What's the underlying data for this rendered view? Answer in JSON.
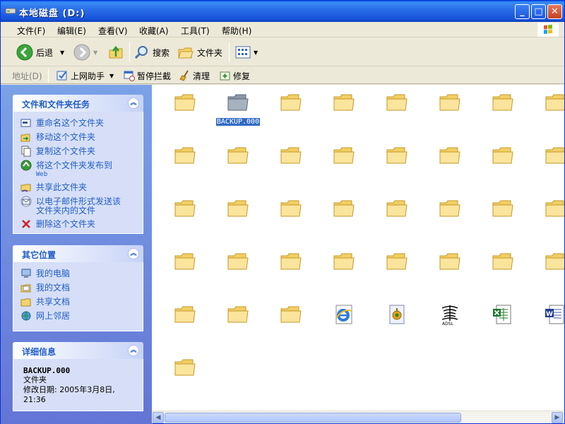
{
  "window": {
    "title": "本地磁盘 (D:)",
    "minimize_icon": "minimize-icon",
    "maximize_icon": "maximize-icon",
    "close_icon": "close-icon"
  },
  "menu": {
    "file": "文件(F)",
    "edit": "编辑(E)",
    "view": "查看(V)",
    "favorites": "收藏(A)",
    "tools": "工具(T)",
    "help": "帮助(H)"
  },
  "toolbar": {
    "back": "后退",
    "search": "搜索",
    "folders": "文件夹"
  },
  "address_bar": {
    "label": "地址(D)",
    "links": [
      "上网助手",
      "暂停拦截",
      "清理",
      "修复"
    ]
  },
  "file_tasks": {
    "title": "文件和文件夹任务",
    "items": [
      {
        "label": "重命名这个文件夹",
        "sub": ""
      },
      {
        "label": "移动这个文件夹",
        "sub": ""
      },
      {
        "label": "复制这个文件夹",
        "sub": ""
      },
      {
        "label": "将这个文件夹发布到",
        "sub": "Web"
      },
      {
        "label": "共享此文件夹",
        "sub": ""
      },
      {
        "label": "以电子邮件形式发送该文件夹内的文件",
        "sub": ""
      },
      {
        "label": "删除这个文件夹",
        "sub": ""
      }
    ]
  },
  "other_places": {
    "title": "其它位置",
    "items": [
      "我的电脑",
      "我的文档",
      "共享文档",
      "网上邻居"
    ]
  },
  "details": {
    "title": "详细信息",
    "name": "BACKUP.000",
    "type": "文件夹",
    "modified": "修改日期: 2005年3月8日, 21:36"
  },
  "files": [
    {
      "kind": "folder",
      "name": ""
    },
    {
      "kind": "folder-gray",
      "name": "BACKUP.000",
      "selected": true
    },
    {
      "kind": "folder",
      "name": ""
    },
    {
      "kind": "folder",
      "name": ""
    },
    {
      "kind": "folder",
      "name": ""
    },
    {
      "kind": "folder",
      "name": ""
    },
    {
      "kind": "folder",
      "name": ""
    },
    {
      "kind": "folder",
      "name": ""
    },
    {
      "kind": "folder",
      "name": ""
    },
    {
      "kind": "folder",
      "name": ""
    },
    {
      "kind": "folder",
      "name": ""
    },
    {
      "kind": "folder",
      "name": ""
    },
    {
      "kind": "folder",
      "name": ""
    },
    {
      "kind": "folder",
      "name": ""
    },
    {
      "kind": "folder",
      "name": ""
    },
    {
      "kind": "folder",
      "name": ""
    },
    {
      "kind": "folder",
      "name": ""
    },
    {
      "kind": "folder",
      "name": ""
    },
    {
      "kind": "folder",
      "name": ""
    },
    {
      "kind": "folder",
      "name": ""
    },
    {
      "kind": "folder",
      "name": ""
    },
    {
      "kind": "folder",
      "name": ""
    },
    {
      "kind": "folder",
      "name": ""
    },
    {
      "kind": "folder",
      "name": ""
    },
    {
      "kind": "folder",
      "name": ""
    },
    {
      "kind": "folder",
      "name": ""
    },
    {
      "kind": "folder",
      "name": ""
    },
    {
      "kind": "folder",
      "name": ""
    },
    {
      "kind": "folder",
      "name": ""
    },
    {
      "kind": "folder",
      "name": ""
    },
    {
      "kind": "folder",
      "name": ""
    },
    {
      "kind": "folder",
      "name": ""
    },
    {
      "kind": "folder",
      "name": ""
    },
    {
      "kind": "folder",
      "name": ""
    },
    {
      "kind": "folder",
      "name": ""
    },
    {
      "kind": "ie",
      "name": ""
    },
    {
      "kind": "setup",
      "name": ""
    },
    {
      "kind": "adsl",
      "name": ""
    },
    {
      "kind": "excel",
      "name": ""
    },
    {
      "kind": "word",
      "name": ""
    },
    {
      "kind": "folder",
      "name": ""
    }
  ]
}
